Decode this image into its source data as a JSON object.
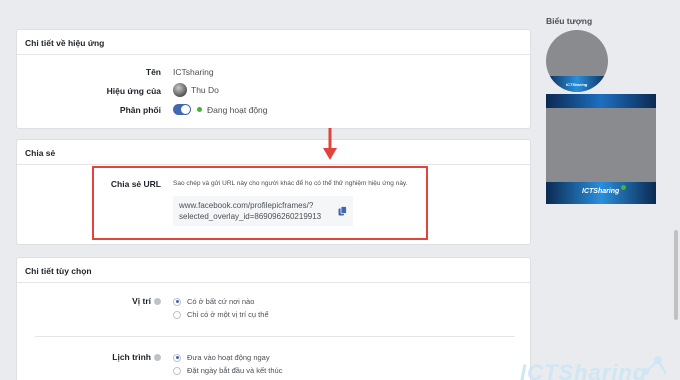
{
  "effect_details": {
    "title": "Chi tiết về hiệu ứng",
    "name_label": "Tên",
    "name_value": "ICTsharing",
    "owner_label": "Hiệu ứng của",
    "owner_value": "Thu Do",
    "distribution_label": "Phân phối",
    "distribution_status": "Đang hoạt động"
  },
  "share": {
    "title": "Chia sẻ",
    "url_label": "Chia sẻ URL",
    "description": "Sao chép và gửi URL này cho người khác để họ có thể thử nghiệm hiệu ứng này.",
    "url_line1": "www.facebook.com/profilepicframes/?",
    "url_line2": "selected_overlay_id=869096260219913"
  },
  "optional": {
    "title": "Chi tiết tùy chọn",
    "location_label": "Vị trí",
    "location_options": [
      "Có ở bất cứ nơi nào",
      "Chỉ có ở một vị trí cụ thể"
    ],
    "schedule_label": "Lịch trình",
    "schedule_options": [
      "Đưa vào hoạt động ngay",
      "Đặt ngày bắt đầu và kết thúc"
    ]
  },
  "preview": {
    "title": "Biểu tượng",
    "brand": "ICTSharing"
  },
  "watermark": "ICTSharing",
  "colors": {
    "accent": "#4267b2",
    "active": "#42b72a",
    "highlight": "#e0443b"
  }
}
